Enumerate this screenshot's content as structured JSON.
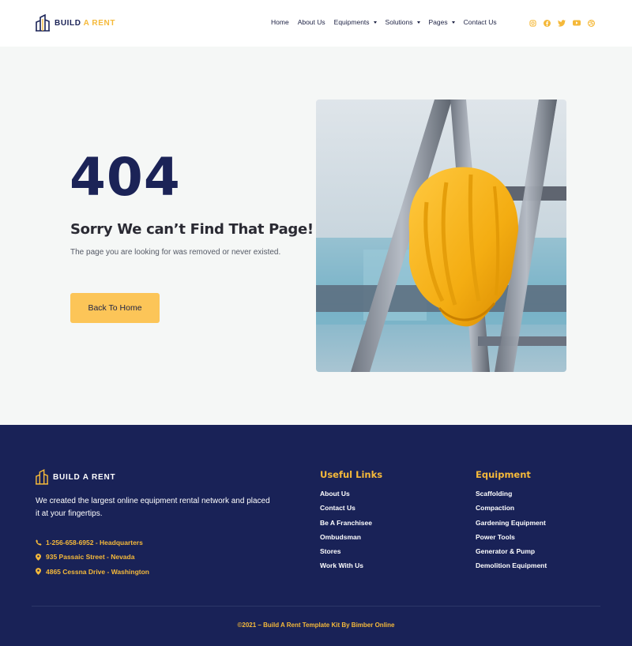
{
  "brand": {
    "name_main": "BUILD",
    "name_accent": "A RENT",
    "footer_name": "BUILD A RENT"
  },
  "nav": {
    "items": [
      {
        "label": "Home",
        "dropdown": false
      },
      {
        "label": "About Us",
        "dropdown": false
      },
      {
        "label": "Equipments",
        "dropdown": true
      },
      {
        "label": "Solutions",
        "dropdown": true
      },
      {
        "label": "Pages",
        "dropdown": true
      },
      {
        "label": "Contact Us",
        "dropdown": false
      }
    ]
  },
  "social": [
    "instagram-icon",
    "facebook-icon",
    "twitter-icon",
    "youtube-icon",
    "dribbble-icon"
  ],
  "hero": {
    "code": "404",
    "title": "Sorry We can’t Find That Page!",
    "description": "The page you are looking for was removed or never existed.",
    "button": "Back To Home"
  },
  "footer": {
    "about": "We created the largest online equipment rental network and placed it at your fingertips.",
    "contacts": [
      {
        "icon": "phone-icon",
        "text": "1-256-658-6952 - Headquarters"
      },
      {
        "icon": "location-pin-icon",
        "text": "935 Passaic Street - Nevada"
      },
      {
        "icon": "location-pin-icon",
        "text": "4865 Cessna Drive - Washington"
      }
    ],
    "useful_links": {
      "heading": "Useful Links",
      "links": [
        "About Us",
        "Contact Us",
        "Be A Franchisee",
        "Ombudsman",
        "Stores",
        "Work With Us"
      ]
    },
    "equipment": {
      "heading": "Equipment",
      "links": [
        "Scaffolding",
        "Compaction",
        "Gardening Equipment",
        "Power Tools",
        "Generator & Pump",
        "Demolition Equipment"
      ]
    },
    "copyright": "©2021 – Build A Rent Template Kit By Bimber Online"
  },
  "colors": {
    "navy": "#192257",
    "accent": "#f5b93a",
    "button": "#fcc558",
    "hero_bg": "#f5f7f6"
  }
}
